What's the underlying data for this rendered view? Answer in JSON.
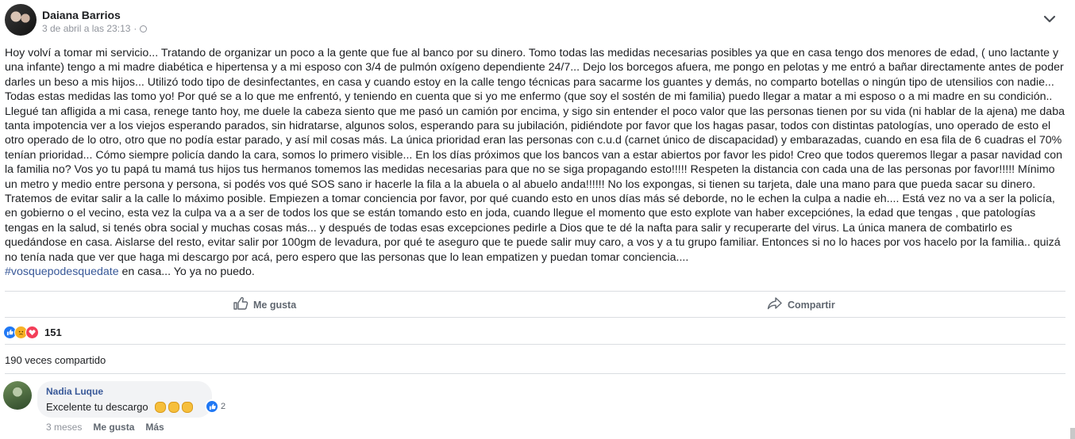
{
  "post": {
    "author": "Daiana Barrios",
    "timestamp": "3 de abril a las 23:13",
    "separator": "·",
    "privacy_icon": "globe-icon",
    "body": "Hoy volví a tomar mi servicio... Tratando de organizar un poco a la gente que fue al banco por su dinero. Tomo todas las medidas necesarias posibles ya que en casa tengo dos menores de edad, ( uno lactante y una infante) tengo a mi madre diabética e hipertensa y a mi esposo con 3/4 de pulmón oxígeno dependiente 24/7... Dejo los borcegos afuera, me pongo en pelotas y me entró a bañar directamente antes de poder darles un beso a mis hijos... Utilizó todo tipo de desinfectantes, en casa y cuando estoy en la calle tengo técnicas para sacarme los guantes y demás, no comparto botellas o ningún tipo de utensilios con nadie... Todas estas medidas las tomo yo! Por qué se a lo que me enfrentó, y teniendo en cuenta que si yo me enfermo (que soy el sostén de mi familia) puedo llegar a matar a mi esposo o a mi madre en su condición.. Llegué tan afligida a mi casa, renege tanto hoy, me duele la cabeza siento que me pasó un camión por encima, y sigo sin entender el poco valor que las personas tienen por su vida (ni hablar de la ajena) me daba tanta impotencia ver a los viejos esperando parados, sin hidratarse, algunos solos, esperando para su jubilación, pidiéndote por favor que los hagas pasar, todos con distintas patologías, uno operado de esto el otro operado de lo otro, otro que no podía estar parado, y así mil cosas más. La única prioridad eran las personas con c.u.d (carnet único de discapacidad) y embarazadas, cuando en esa fila de 6 cuadras el 70% tenían prioridad... Cómo siempre policía dando la cara, somos lo primero visible... En los días próximos que los bancos van a estar abiertos por favor les pido! Creo que todos queremos llegar a pasar navidad con la familia no? Vos yo tu papá tu mamá tus hijos tus hermanos tomemos las medidas necesarias para que no se siga propagando esto!!!!! Respeten la distancia con cada una de las personas por favor!!!!! Mínimo un metro y medio entre persona y persona, si podés vos qué SOS sano ir hacerle la fila a la abuela o al abuelo anda!!!!!! No los expongas, si tienen su tarjeta, dale una mano para que pueda sacar su dinero. Tratemos de evitar salir a la calle lo máximo posible. Empiezen a tomar conciencia por favor, por qué cuando esto en unos días más sé deborde, no le echen la culpa a nadie eh.... Está vez no va a ser la policía, en gobierno o el vecino, esta vez la culpa va a a ser de todos los que se están tomando esto en joda, cuando llegue el momento que esto explote van haber excepciónes, la edad que tengas , que patologías tengas en la salud, si tenés obra social y muchas cosas más... y después de todas esas excepciones pedirle a Dios que te dé la nafta para salir y recuperarte del virus. La única manera de combatirlo es quedándose en casa. Aislarse del resto, evitar salir por 100gm de levadura, por qué te aseguro que te puede salir muy caro, a vos y a tu grupo familiar. Entonces si no lo haces por vos hacelo por la familia.. quizá no tenía nada que ver que haga mi descargo por acá, pero espero que las personas que lo lean empatizen y puedan tomar conciencia....",
    "hashtag": "#vosquepodesquedate",
    "tail": " en casa... Yo ya no puedo."
  },
  "actions": {
    "like_label": "Me gusta",
    "share_label": "Compartir"
  },
  "reactions": {
    "types": [
      "like",
      "sad",
      "love"
    ],
    "count": "151"
  },
  "shares": "190 veces compartido",
  "comment": {
    "author": "Nadia Luque",
    "text": "Excelente tu descargo",
    "emoji_name": "clapping-hands",
    "emoji_count": 3,
    "reaction_count": "2",
    "age": "3 meses",
    "like_label": "Me gusta",
    "more_label": "Más"
  },
  "colors": {
    "link": "#385898",
    "like_blue": "#2078f4",
    "love_red": "#f33e58",
    "sad_yellow": "#f7b125"
  }
}
